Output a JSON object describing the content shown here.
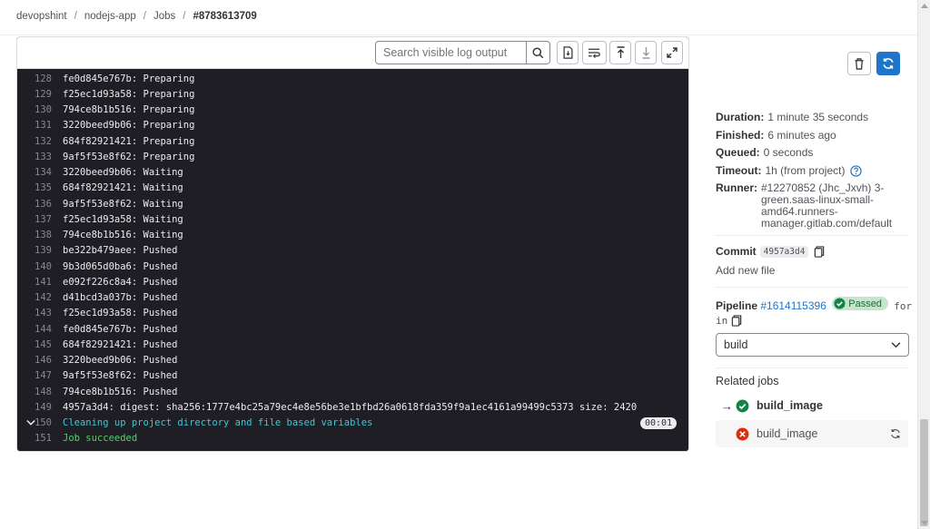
{
  "breadcrumb": [
    "devopshint",
    "nodejs-app",
    "Jobs",
    "#8783613709"
  ],
  "toolbar": {
    "search_placeholder": "Search visible log output"
  },
  "log": {
    "lines": [
      {
        "n": "128",
        "t": "fe0d845e767b: Preparing"
      },
      {
        "n": "129",
        "t": "f25ec1d93a58: Preparing"
      },
      {
        "n": "130",
        "t": "794ce8b1b516: Preparing"
      },
      {
        "n": "131",
        "t": "3220beed9b06: Preparing"
      },
      {
        "n": "132",
        "t": "684f82921421: Preparing"
      },
      {
        "n": "133",
        "t": "9af5f53e8f62: Preparing"
      },
      {
        "n": "134",
        "t": "3220beed9b06: Waiting"
      },
      {
        "n": "135",
        "t": "684f82921421: Waiting"
      },
      {
        "n": "136",
        "t": "9af5f53e8f62: Waiting"
      },
      {
        "n": "137",
        "t": "f25ec1d93a58: Waiting"
      },
      {
        "n": "138",
        "t": "794ce8b1b516: Waiting"
      },
      {
        "n": "139",
        "t": "be322b479aee: Pushed"
      },
      {
        "n": "140",
        "t": "9b3d065d0ba6: Pushed"
      },
      {
        "n": "141",
        "t": "e092f226c8a4: Pushed"
      },
      {
        "n": "142",
        "t": "d41bcd3a037b: Pushed"
      },
      {
        "n": "143",
        "t": "f25ec1d93a58: Pushed"
      },
      {
        "n": "144",
        "t": "fe0d845e767b: Pushed"
      },
      {
        "n": "145",
        "t": "684f82921421: Pushed"
      },
      {
        "n": "146",
        "t": "3220beed9b06: Pushed"
      },
      {
        "n": "147",
        "t": "9af5f53e8f62: Pushed"
      },
      {
        "n": "148",
        "t": "794ce8b1b516: Pushed"
      },
      {
        "n": "149",
        "t": "4957a3d4: digest: sha256:1777e4bc25a79ec4e8e56be3e1bfbd26a0618fda359f9a1ec4161a99499c5373 size: 2420"
      },
      {
        "n": "150",
        "t": "Cleaning up project directory and file based variables",
        "style": "cyan",
        "timer": "00:01",
        "collapsible": true
      },
      {
        "n": "151",
        "t": "Job succeeded",
        "style": "green"
      }
    ]
  },
  "sidebar": {
    "duration_label": "Duration:",
    "duration": "1 minute 35 seconds",
    "finished_label": "Finished:",
    "finished": "6 minutes ago",
    "queued_label": "Queued:",
    "queued": "0 seconds",
    "timeout_label": "Timeout:",
    "timeout": "1h (from project)",
    "runner_label": "Runner:",
    "runner": "#12270852 (Jhc_Jxvh) 3-green.saas-linux-small-amd64.runners-manager.gitlab.com/default",
    "commit_label": "Commit",
    "commit_sha": "4957a3d4",
    "commit_message": "Add new file",
    "pipeline_label": "Pipeline",
    "pipeline_id": "#1614115396",
    "pipeline_status": "Passed",
    "pipeline_for": "for ma",
    "pipeline_in": "in",
    "stage": "build",
    "related_jobs_title": "Related jobs",
    "related_jobs": [
      {
        "name": "build_image",
        "status": "success"
      },
      {
        "name": "build_image",
        "status": "failed"
      }
    ]
  },
  "colors": {
    "log_bg": "#1f1e24",
    "accent": "#1f75cb",
    "success": "#108548",
    "failed": "#dd2b0e"
  }
}
